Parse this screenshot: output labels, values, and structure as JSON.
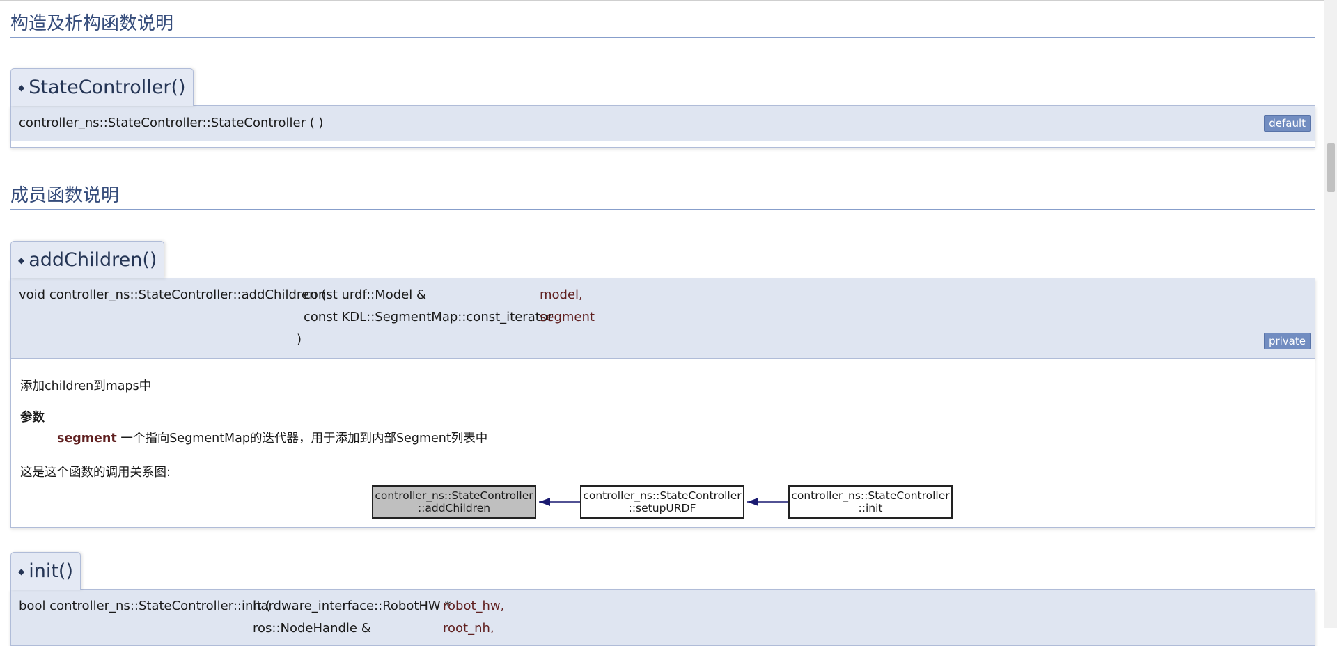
{
  "sections": {
    "ctor_title": "构造及析构函数说明",
    "member_title": "成员函数说明"
  },
  "ctor": {
    "tab": "StateController()",
    "proto": "controller_ns::StateController::StateController ( )",
    "badge": "default"
  },
  "addChildren": {
    "tab": "addChildren()",
    "head": "void controller_ns::StateController::addChildren ( ",
    "arg1_type": "const urdf::Model & ",
    "arg1_name": "model,",
    "arg2_type": "const KDL::SegmentMap::const_iterator ",
    "arg2_name": "segment",
    "close": ")",
    "badge": "private",
    "brief": "添加children到maps中",
    "params_title": "参数",
    "param_name": "segment",
    "param_desc": " 一个指向SegmentMap的迭代器，用于添加到内部Segment列表中",
    "callgraph_label": "这是这个函数的调用关系图:",
    "nodes": [
      {
        "l1": "controller_ns::StateController",
        "l2": "::addChildren"
      },
      {
        "l1": "controller_ns::StateController",
        "l2": "::setupURDF"
      },
      {
        "l1": "controller_ns::StateController",
        "l2": "::init"
      }
    ]
  },
  "init": {
    "tab": "init()",
    "head": "bool controller_ns::StateController::init ( ",
    "arg1_type": "hardware_interface::RobotHW * ",
    "arg1_name": "robot_hw,",
    "arg2_type": "ros::NodeHandle & ",
    "arg2_name": "root_nh,"
  },
  "colors": {
    "section": "#354c7b",
    "proto_bg": "#dfe5f1",
    "param": "#602020",
    "badge": "#728dc1"
  }
}
